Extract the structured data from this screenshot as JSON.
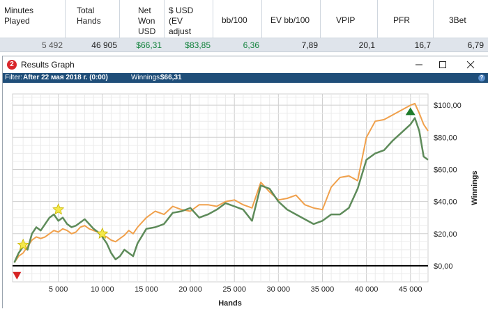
{
  "stats": {
    "headers": [
      "Minutes\nPlayed",
      "Total\nHands",
      "Net\nWon\nUSD",
      "$ USD\n(EV\nadjust",
      "bb/100",
      "EV bb/100",
      "VPIP",
      "PFR",
      "3Bet"
    ],
    "values": [
      "5 492",
      "46 905",
      "$66,31",
      "$83,85",
      "6,36",
      "7,89",
      "20,1",
      "16,7",
      "6,79"
    ]
  },
  "window": {
    "title": "Results Graph",
    "controls": [
      "—",
      "☐",
      "✕"
    ]
  },
  "filter": {
    "label": "Filter:",
    "value": "After 22 мая 2018 г. (0:00)",
    "winnings_label": "Winnings:",
    "winnings_value": "$66,31",
    "help": "?"
  },
  "chart_data": {
    "type": "line",
    "xlabel": "Hands",
    "ylabel": "Winnings",
    "xlim": [
      -200,
      47000
    ],
    "ylim": [
      -10,
      107
    ],
    "x_ticks": [
      5000,
      10000,
      15000,
      20000,
      25000,
      30000,
      35000,
      40000,
      45000
    ],
    "x_tick_labels": [
      "5 000",
      "10 000",
      "15 000",
      "20 000",
      "25 000",
      "30 000",
      "35 000",
      "40 000",
      "45 000"
    ],
    "y_ticks": [
      0,
      20,
      40,
      60,
      80,
      100
    ],
    "y_tick_labels": [
      "$0,00",
      "$20,00",
      "$40,00",
      "$60,00",
      "$80,00",
      "$100,00"
    ],
    "grid": true,
    "series": [
      {
        "color": "#f0a04b",
        "x": [
          0,
          500,
          1000,
          1500,
          2000,
          2500,
          3000,
          3500,
          4000,
          4500,
          5000,
          5500,
          6000,
          6500,
          7000,
          7500,
          8000,
          8500,
          9000,
          9500,
          10000,
          10500,
          11000,
          11500,
          12000,
          12500,
          13000,
          13500,
          14000,
          15000,
          16000,
          17000,
          18000,
          19000,
          20000,
          21000,
          22000,
          23000,
          24000,
          25000,
          26000,
          27000,
          28000,
          29000,
          30000,
          31000,
          32000,
          33000,
          34000,
          35000,
          36000,
          37000,
          38000,
          39000,
          40000,
          41000,
          42000,
          43000,
          44000,
          45000,
          45500,
          46000,
          46500,
          47000
        ],
        "y": [
          2,
          6,
          8,
          12,
          16,
          18,
          17,
          18,
          20,
          22,
          21,
          23,
          22,
          20,
          21,
          24,
          25,
          23,
          22,
          21,
          19,
          18,
          16,
          15,
          17,
          19,
          22,
          20,
          24,
          30,
          34,
          32,
          37,
          35,
          34,
          38,
          38,
          37,
          40,
          41,
          38,
          36,
          52,
          46,
          41,
          42,
          44,
          38,
          36,
          35,
          49,
          55,
          56,
          53,
          80,
          90,
          91,
          94,
          97,
          100,
          101,
          95,
          88,
          84
        ]
      },
      {
        "color": "#5e8b5a",
        "x": [
          0,
          500,
          1000,
          1500,
          2000,
          2500,
          3000,
          3500,
          4000,
          4500,
          5000,
          5500,
          6000,
          6500,
          7000,
          7500,
          8000,
          8500,
          9000,
          9500,
          10000,
          10500,
          11000,
          11500,
          12000,
          12500,
          13000,
          13500,
          14000,
          15000,
          16000,
          17000,
          18000,
          19000,
          20000,
          21000,
          22000,
          23000,
          24000,
          25000,
          26000,
          27000,
          28000,
          29000,
          30000,
          31000,
          32000,
          33000,
          34000,
          35000,
          36000,
          37000,
          38000,
          39000,
          40000,
          41000,
          42000,
          43000,
          44000,
          45000,
          45500,
          46000,
          46500,
          47000
        ],
        "y": [
          2,
          8,
          12,
          10,
          20,
          24,
          22,
          26,
          30,
          32,
          28,
          30,
          26,
          24,
          25,
          27,
          29,
          26,
          23,
          21,
          18,
          14,
          8,
          4,
          6,
          10,
          8,
          6,
          14,
          23,
          24,
          26,
          33,
          34,
          36,
          30,
          32,
          35,
          39,
          37,
          35,
          28,
          50,
          48,
          40,
          35,
          32,
          29,
          26,
          28,
          32,
          32,
          36,
          48,
          66,
          70,
          72,
          78,
          83,
          88,
          92,
          84,
          68,
          66
        ]
      }
    ],
    "markers": [
      {
        "kind": "star",
        "x": 1000,
        "y": 13,
        "color": "#f4e84a"
      },
      {
        "kind": "star",
        "x": 5000,
        "y": 35,
        "color": "#f4e84a"
      },
      {
        "kind": "star",
        "x": 10000,
        "y": 20,
        "color": "#f4e84a"
      },
      {
        "kind": "triangle-down",
        "x": 300,
        "y": -6,
        "color": "#d62424"
      },
      {
        "kind": "triangle-up",
        "x": 45000,
        "y": 96,
        "color": "#1e7b2a"
      }
    ]
  }
}
